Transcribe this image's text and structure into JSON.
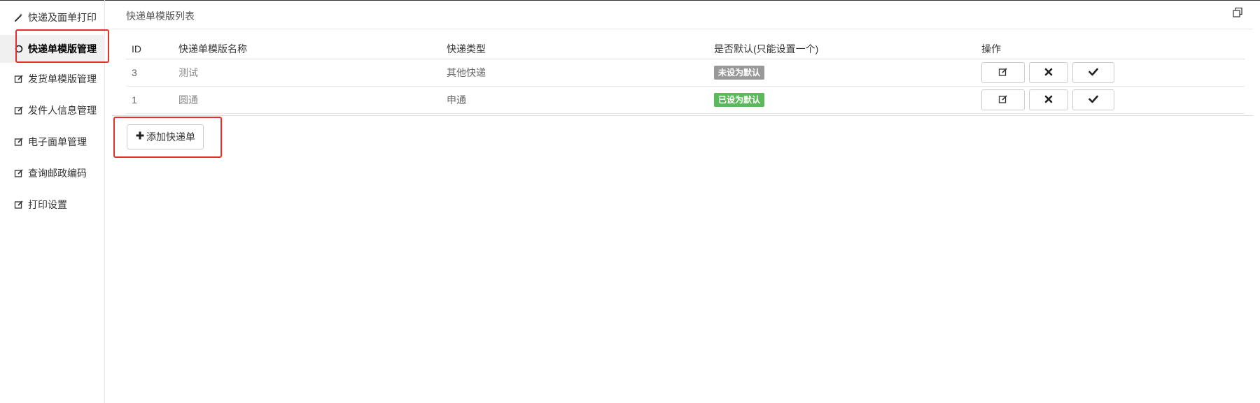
{
  "sidebar": {
    "items": [
      {
        "label": "快递及面单打印",
        "icon": "magic-wand-icon"
      },
      {
        "label": "快递单模版管理",
        "icon": "circle-icon",
        "active": true
      },
      {
        "label": "发货单模版管理",
        "icon": "edit-icon"
      },
      {
        "label": "发件人信息管理",
        "icon": "edit-icon"
      },
      {
        "label": "电子面单管理",
        "icon": "edit-icon"
      },
      {
        "label": "查询邮政编码",
        "icon": "edit-icon"
      },
      {
        "label": "打印设置",
        "icon": "edit-icon"
      }
    ]
  },
  "header": {
    "title": "快递单模版列表",
    "window_icon": "restore-window-icon"
  },
  "table": {
    "columns": [
      "ID",
      "快递单模版名称",
      "快递类型",
      "是否默认(只能设置一个)",
      "操作"
    ],
    "rows": [
      {
        "id": "3",
        "name": "测试",
        "type": "其他快递",
        "default_label": "未设为默认",
        "default_status": "not-default"
      },
      {
        "id": "1",
        "name": "圆通",
        "type": "申通",
        "default_label": "已设为默认",
        "default_status": "default"
      }
    ],
    "actions": [
      "edit-icon",
      "delete-icon",
      "check-icon"
    ]
  },
  "add_button": {
    "label": "添加快递单",
    "icon": "plus-icon"
  },
  "colors": {
    "badge_grey": "#999999",
    "badge_green": "#5cb85c",
    "highlight_red": "#e62e2e"
  }
}
